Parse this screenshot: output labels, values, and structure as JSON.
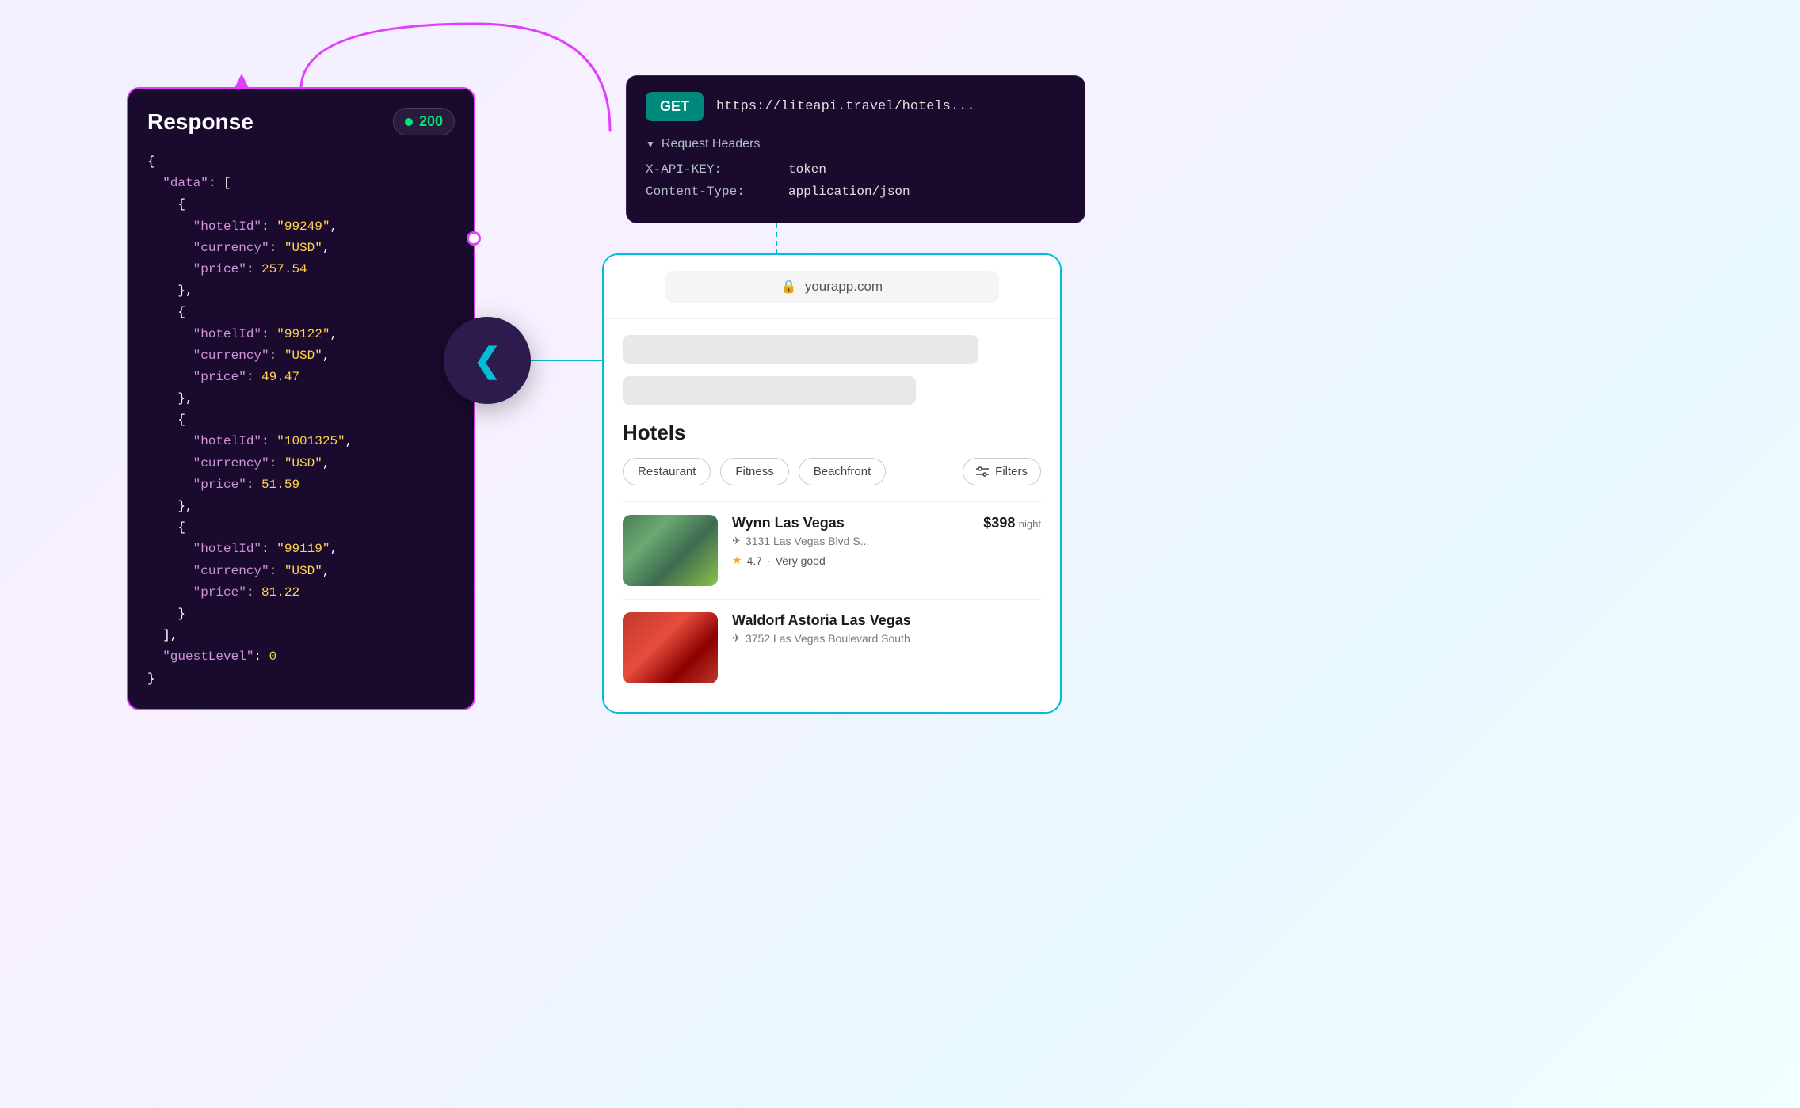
{
  "response_card": {
    "title": "Response",
    "status_code": "200",
    "json": {
      "data_label": "\"data\"",
      "hotel1": {
        "hotelId_key": "\"hotelId\"",
        "hotelId_val": "\"99249\"",
        "currency_key": "\"currency\"",
        "currency_val": "\"USD\"",
        "price_key": "\"price\"",
        "price_val": "257.54"
      },
      "hotel2": {
        "hotelId_key": "\"hotelId\"",
        "hotelId_val": "\"99122\"",
        "currency_key": "\"currency\"",
        "currency_val": "\"USD\"",
        "price_key": "\"price\"",
        "price_val": "49.47"
      },
      "hotel3": {
        "hotelId_key": "\"hotelId\"",
        "hotelId_val": "\"1001325\"",
        "currency_key": "\"currency\"",
        "currency_val": "\"USD\"",
        "price_key": "\"price\"",
        "price_val": "51.59"
      },
      "hotel4": {
        "hotelId_key": "\"hotelId\"",
        "hotelId_val": "\"99119\"",
        "currency_key": "\"currency\"",
        "currency_val": "\"USD\"",
        "price_key": "\"price\"",
        "price_val": "81.22"
      },
      "guestLevel_key": "\"guestLevel\"",
      "guestLevel_val": "0"
    }
  },
  "api_card": {
    "method": "GET",
    "url": "https://liteapi.travel/hotels...",
    "headers_label": "Request Headers",
    "headers": [
      {
        "key": "X-API-KEY:",
        "value": "token"
      },
      {
        "key": "Content-Type:",
        "value": "application/json"
      }
    ]
  },
  "browser_card": {
    "address": "yourapp.com",
    "hotels_title": "Hotels",
    "filters": [
      "Restaurant",
      "Fitness",
      "Beachfront"
    ],
    "filters_btn": "Filters",
    "hotels": [
      {
        "name": "Wynn Las Vegas",
        "address": "3131 Las Vegas Blvd S...",
        "rating": "4.7",
        "rating_label": "Very good",
        "price": "$398",
        "price_unit": "night"
      },
      {
        "name": "Waldorf Astoria Las Vegas",
        "address": "3752 Las Vegas Boulevard South",
        "rating": "",
        "rating_label": "",
        "price": "",
        "price_unit": ""
      }
    ]
  },
  "logo": {
    "icon": "❮"
  },
  "colors": {
    "pink": "#e040fb",
    "teal": "#00bcd4",
    "dark_bg": "#1a0a2e",
    "green": "#00e676"
  }
}
